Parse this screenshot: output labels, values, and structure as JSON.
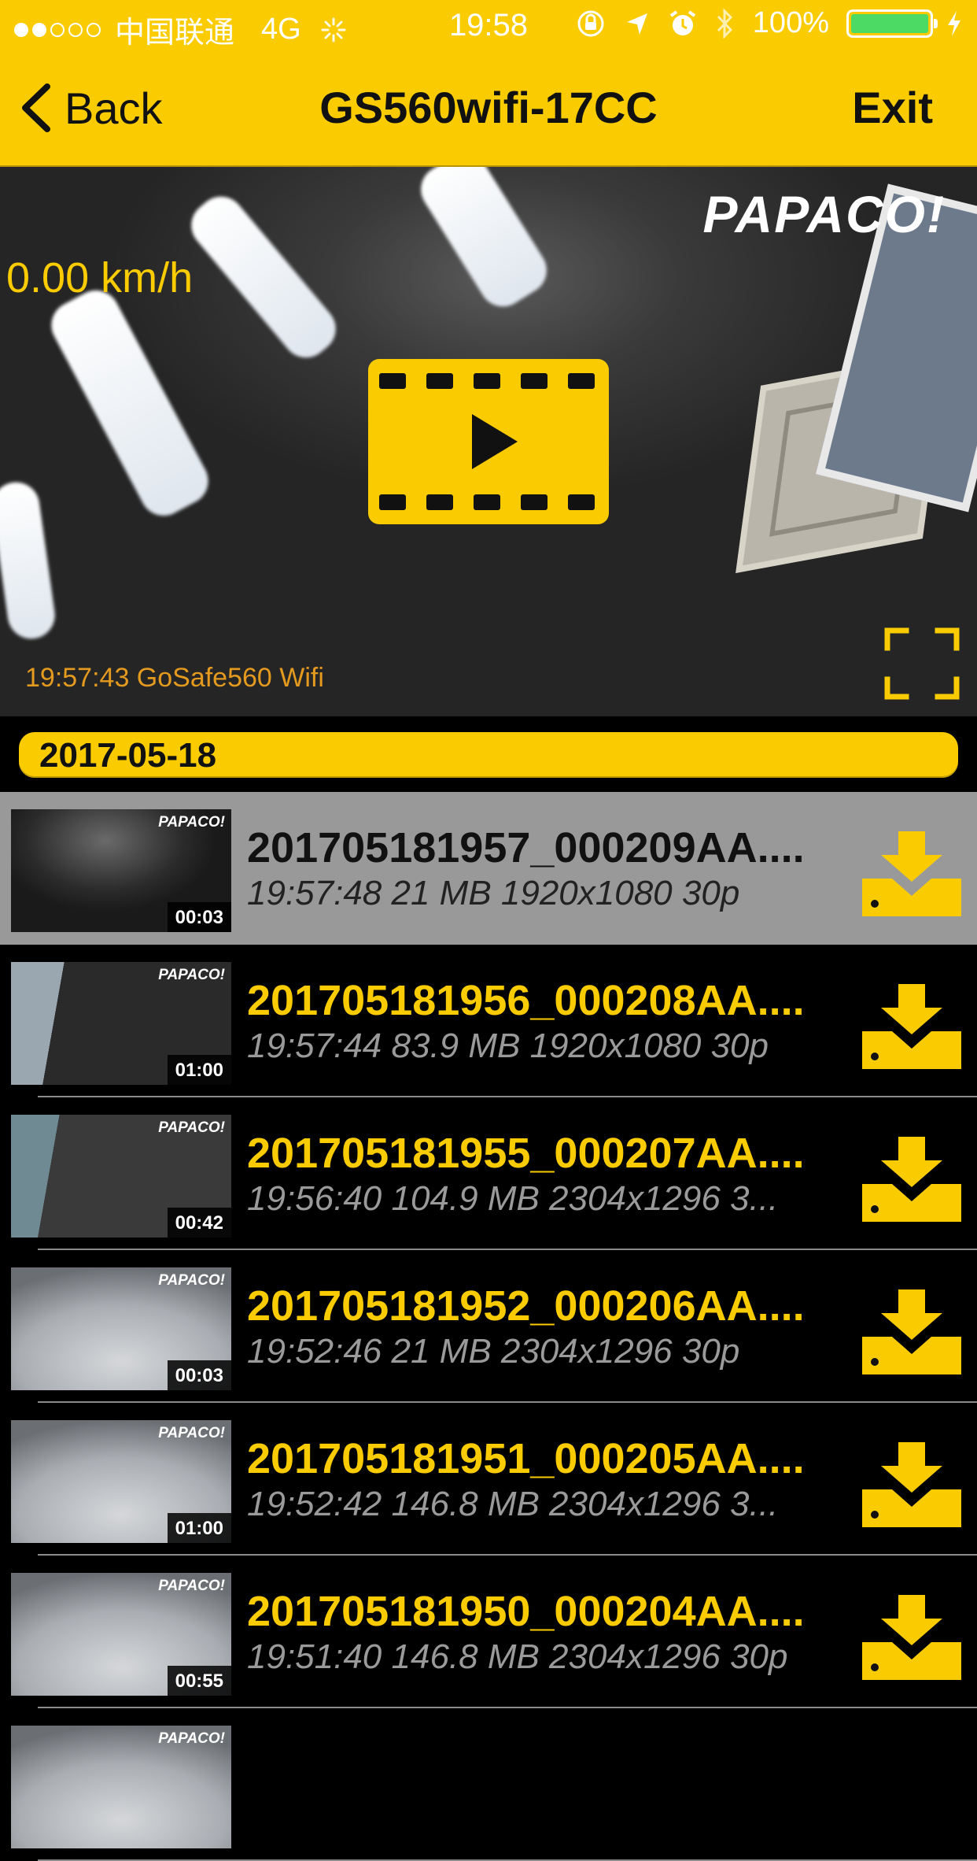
{
  "status_bar": {
    "carrier": "中国联通",
    "network": "4G",
    "time": "19:58",
    "battery": "100%",
    "signal_bars_filled": 2,
    "signal_bars_total": 5,
    "battery_level": 1.0,
    "icons": [
      "signal-dots-icon",
      "loading-icon",
      "orientation-lock-icon",
      "location-icon",
      "alarm-icon",
      "bluetooth-icon",
      "battery-icon",
      "charging-icon"
    ]
  },
  "nav": {
    "back_label": "Back",
    "title": "GS560wifi-17CC",
    "exit_label": "Exit"
  },
  "video": {
    "speed": "0.00 km/h",
    "brand": "PAPACO!",
    "overlay_stamp": "19:57:43  GoSafe560 Wifi"
  },
  "date_header": "2017-05-18",
  "files": [
    {
      "name": "201705181957_000209AA....",
      "meta": "19:57:48 21 MB 1920x1080 30p",
      "duration": "00:03",
      "thumb_logo": "PAPACO!",
      "selected": true,
      "scene": "ceiling"
    },
    {
      "name": "201705181956_000208AA....",
      "meta": "19:57:44 83.9 MB 1920x1080 30p",
      "duration": "01:00",
      "thumb_logo": "PAPACO!",
      "selected": false,
      "scene": "fan"
    },
    {
      "name": "201705181955_000207AA....",
      "meta": "19:56:40 104.9 MB 2304x1296 3...",
      "duration": "00:42",
      "thumb_logo": "PAPACO!",
      "selected": false,
      "scene": "fan2"
    },
    {
      "name": "201705181952_000206AA....",
      "meta": "19:52:46 21 MB 2304x1296 30p",
      "duration": "00:03",
      "thumb_logo": "PAPACO!",
      "selected": false,
      "scene": "dash"
    },
    {
      "name": "201705181951_000205AA....",
      "meta": "19:52:42 146.8 MB 2304x1296 3...",
      "duration": "01:00",
      "thumb_logo": "PAPACO!",
      "selected": false,
      "scene": "dash"
    },
    {
      "name": "201705181950_000204AA....",
      "meta": "19:51:40 146.8 MB 2304x1296 30p",
      "duration": "00:55",
      "thumb_logo": "PAPACO!",
      "selected": false,
      "scene": "dash"
    },
    {
      "name": "",
      "meta": "",
      "duration": "",
      "thumb_logo": "PAPACO!",
      "selected": false,
      "scene": "dash"
    }
  ],
  "colors": {
    "accent": "#FACC00",
    "background": "#000000",
    "selected_row": "#999999",
    "battery_green": "#4CD964"
  }
}
